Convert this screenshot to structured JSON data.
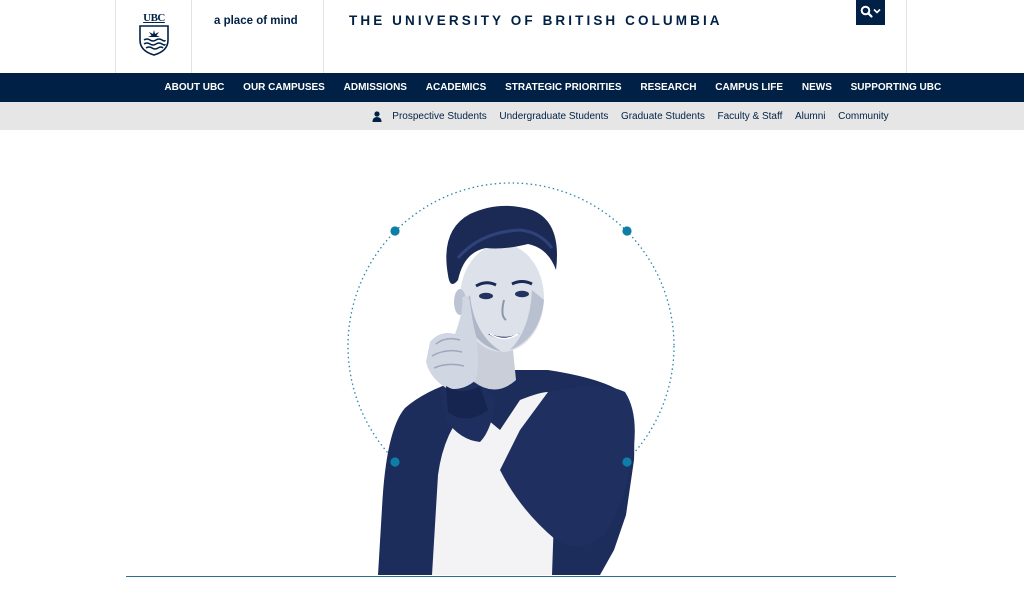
{
  "header": {
    "logo_text": "UBC",
    "tagline": "a place of mind",
    "wordmark": "THE UNIVERSITY OF BRITISH COLUMBIA",
    "search_icon": "search-icon",
    "dropdown_icon": "chevron-down-icon"
  },
  "primary_nav": {
    "items": [
      {
        "label": "ABOUT UBC"
      },
      {
        "label": "OUR CAMPUSES"
      },
      {
        "label": "ADMISSIONS"
      },
      {
        "label": "ACADEMICS"
      },
      {
        "label": "STRATEGIC PRIORITIES"
      },
      {
        "label": "RESEARCH"
      },
      {
        "label": "CAMPUS LIFE"
      },
      {
        "label": "NEWS"
      },
      {
        "label": "SUPPORTING UBC"
      }
    ]
  },
  "audience_nav": {
    "icon": "person-icon",
    "items": [
      {
        "label": "Prospective Students"
      },
      {
        "label": "Undergraduate Students"
      },
      {
        "label": "Graduate Students"
      },
      {
        "label": "Faculty & Staff"
      },
      {
        "label": "Alumni"
      },
      {
        "label": "Community"
      }
    ]
  },
  "hero": {
    "image": "student-portrait",
    "decoration": "dotted-circle-with-four-dots"
  },
  "colors": {
    "navy": "#002145",
    "accent": "#0d7ea8",
    "audience_bg": "#e6e6e6",
    "rule": "#2a6e99"
  }
}
